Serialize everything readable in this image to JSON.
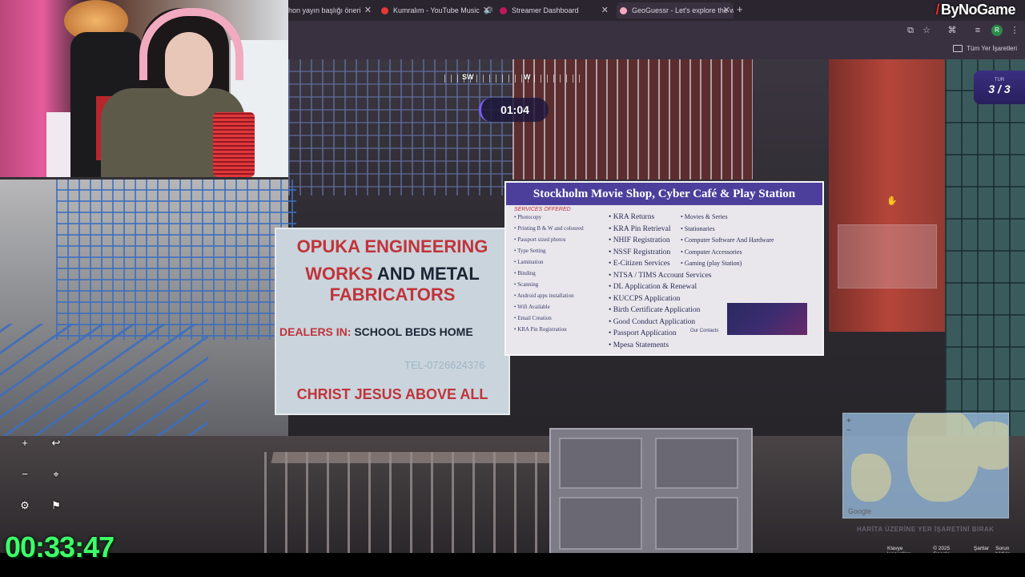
{
  "browser": {
    "tabs": [
      {
        "title": "hon yayın başlığı öneri",
        "color": "#8a7f90"
      },
      {
        "title": "Kumralım - YouTube Music",
        "color": "#e53935",
        "audio": "speaker-icon"
      },
      {
        "title": "Streamer Dashboard",
        "color": "#c2185b"
      },
      {
        "title": "GeoGuessr - Let's explore the w",
        "color": "#f7a8c0",
        "active": true
      }
    ],
    "new_tab": "+",
    "bookmarks_label": "Tüm Yer İşaretleri"
  },
  "overlay": {
    "brand": "ByNoGame",
    "stream_timer": "00:33:47"
  },
  "game": {
    "compass_labels": [
      "SW",
      "W"
    ],
    "round_timer": "01:04",
    "round_label": "TUR",
    "round_value": "3 / 3",
    "map_button": "HARİTA ÜZERİNE YER İŞARETİNİ BIRAK",
    "map_zoom_in": "+",
    "map_zoom_out": "−",
    "map_logo": "Google",
    "attribution": [
      "Klavye kısayolları",
      "© 2025 Google",
      "Şartlar",
      "Sorun bildirin"
    ]
  },
  "scene": {
    "sign_opuka": {
      "line1": "OPUKA ENGINEERING",
      "line2a": "WORKS ",
      "line2b": "AND METAL",
      "line3": "FABRICATORS",
      "dealers_a": "DEALERS IN: ",
      "dealers_b": "SCHOOL BEDS HOME",
      "tel": "TEL-0726624376",
      "footer": "CHRIST JESUS ABOVE ALL"
    },
    "sign_stockholm": {
      "title": "Stockholm Movie Shop, Cyber Café & Play Station",
      "services_offered": "SERVICES OFFERED",
      "col1": [
        "Photocopy",
        "Printing B & W and coloured",
        "Passport sized photos",
        "Type Setting",
        "Lamination",
        "Binding",
        "Scanning",
        "Android apps installation",
        "Wifi Available",
        "Email Creation",
        "KRA Pin Registration"
      ],
      "col2": [
        "KRA Returns",
        "KRA Pin Retrieval",
        "NHIF Registration",
        "NSSF Registration",
        "E-Citizen Services",
        "NTSA / TIMS Account Services",
        "DL Application & Renewal",
        "KUCCPS Application",
        "Birth Certificate Application",
        "Good Conduct Application",
        "Passport Application",
        "Mpesa Statements"
      ],
      "col3": [
        "Movies & Series",
        "Stationaries",
        "Computer Software And Hardware",
        "Computer Accessories",
        "Gaming (play Station)"
      ],
      "contacts": "Our Contacts"
    }
  }
}
